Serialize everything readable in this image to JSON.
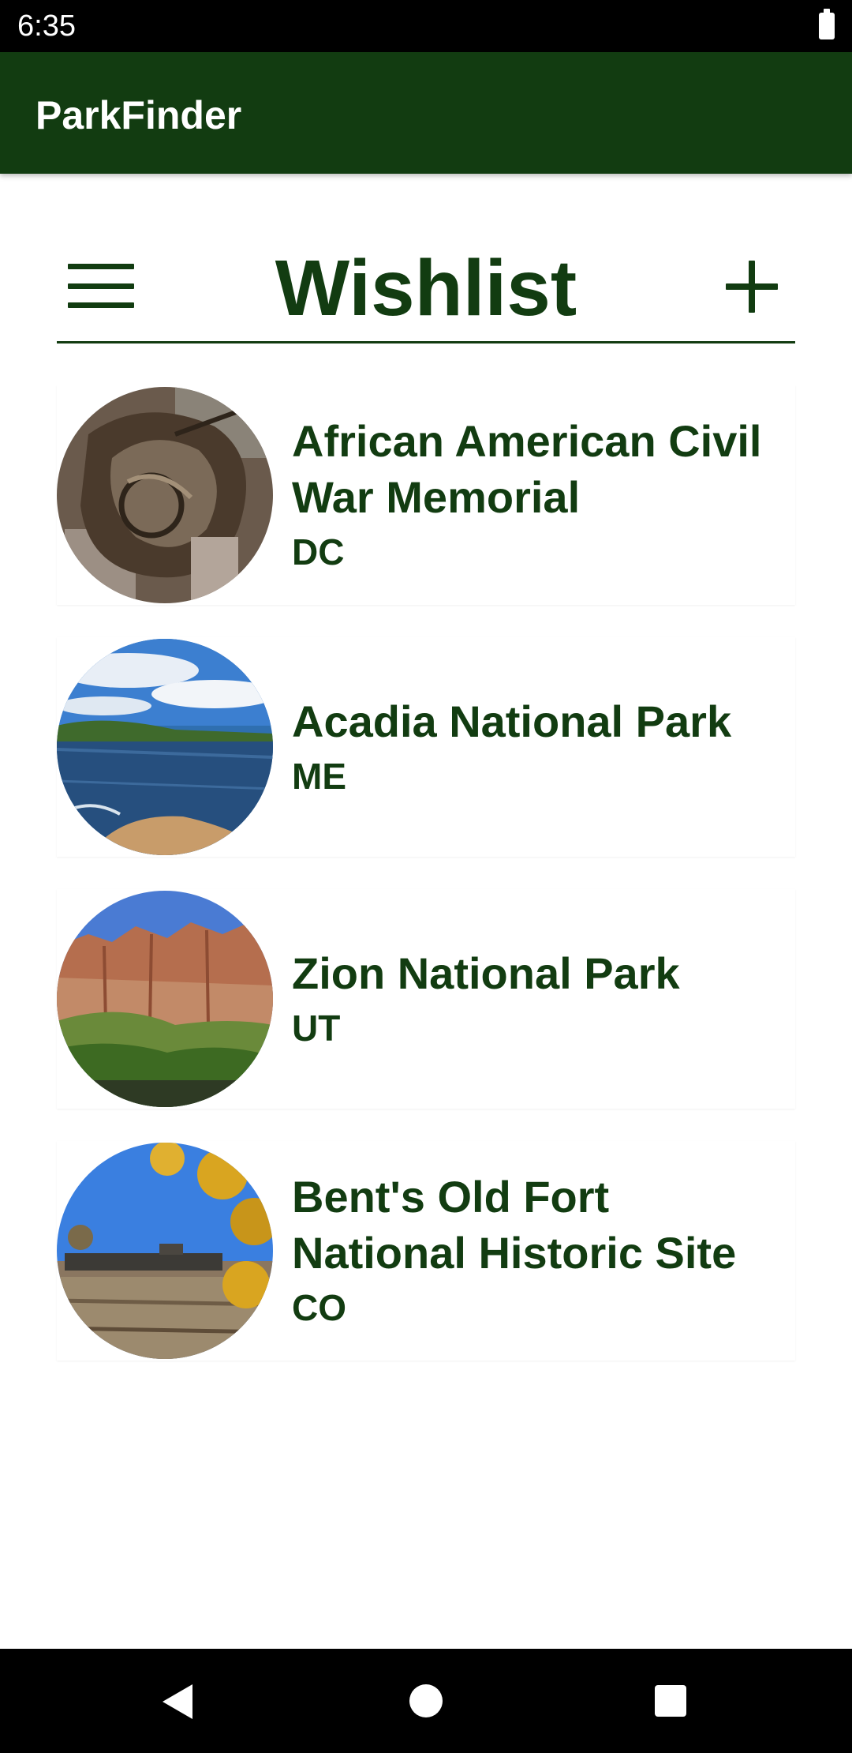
{
  "status_bar": {
    "time": "6:35"
  },
  "app_bar": {
    "title": "ParkFinder"
  },
  "header": {
    "title": "Wishlist"
  },
  "icons": {
    "menu": "hamburger-menu-icon",
    "add": "plus-icon",
    "back": "triangle-back-icon",
    "home": "circle-home-icon",
    "recents": "square-recents-icon"
  },
  "colors": {
    "primary": "#123c11",
    "surface": "#ffffff",
    "system_bars": "#000000"
  },
  "parks": [
    {
      "name": "African American Civil War Memorial",
      "state": "DC"
    },
    {
      "name": "Acadia National Park",
      "state": "ME"
    },
    {
      "name": "Zion National Park",
      "state": "UT"
    },
    {
      "name": "Bent's Old Fort National Historic Site",
      "state": "CO"
    }
  ]
}
